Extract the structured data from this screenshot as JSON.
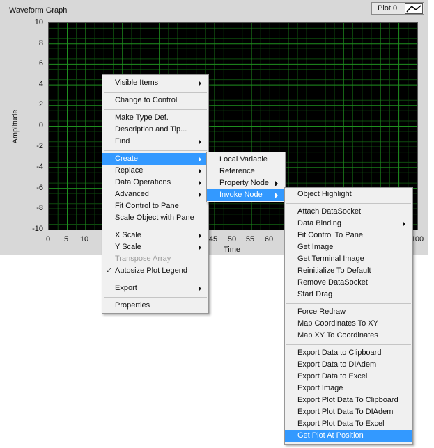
{
  "graph": {
    "title": "Waveform Graph",
    "ylabel": "Amplitude",
    "xlabel": "Time",
    "legend_label": "Plot 0",
    "y_ticks": [
      "10",
      "8",
      "6",
      "4",
      "2",
      "0",
      "-2",
      "-4",
      "-6",
      "-8",
      "-10"
    ],
    "x_ticks": [
      "0",
      "5",
      "10",
      "45",
      "50",
      "55",
      "60",
      "100"
    ],
    "colors": {
      "plot_bg": "#000000",
      "grid": "#1f8f1f",
      "panel": "#d8d8d8"
    }
  },
  "context_menu": {
    "items": [
      "Visible Items",
      "Change to Control",
      "Make Type Def.",
      "Description and Tip...",
      "Find",
      "Create",
      "Replace",
      "Data Operations",
      "Advanced",
      "Fit Control to Pane",
      "Scale Object with Pane",
      "X Scale",
      "Y Scale",
      "Transpose Array",
      "Autosize Plot Legend",
      "Export",
      "Properties"
    ],
    "check_mark": "✓",
    "highlight_color": "#3399ff"
  },
  "create_menu": {
    "items": [
      "Local Variable",
      "Reference",
      "Property Node",
      "Invoke Node"
    ]
  },
  "invoke_menu": {
    "items": [
      "Object Highlight",
      "Attach DataSocket",
      "Data Binding",
      "Fit Control To Pane",
      "Get Image",
      "Get Terminal Image",
      "Reinitialize To Default",
      "Remove DataSocket",
      "Start Drag",
      "Force Redraw",
      "Map Coordinates To XY",
      "Map XY To Coordinates",
      "Export Data to Clipboard",
      "Export Data to DIAdem",
      "Export Data to Excel",
      "Export Image",
      "Export Plot Data To Clipboard",
      "Export Plot Data To DIAdem",
      "Export Plot Data To Excel",
      "Get Plot At Position"
    ]
  }
}
